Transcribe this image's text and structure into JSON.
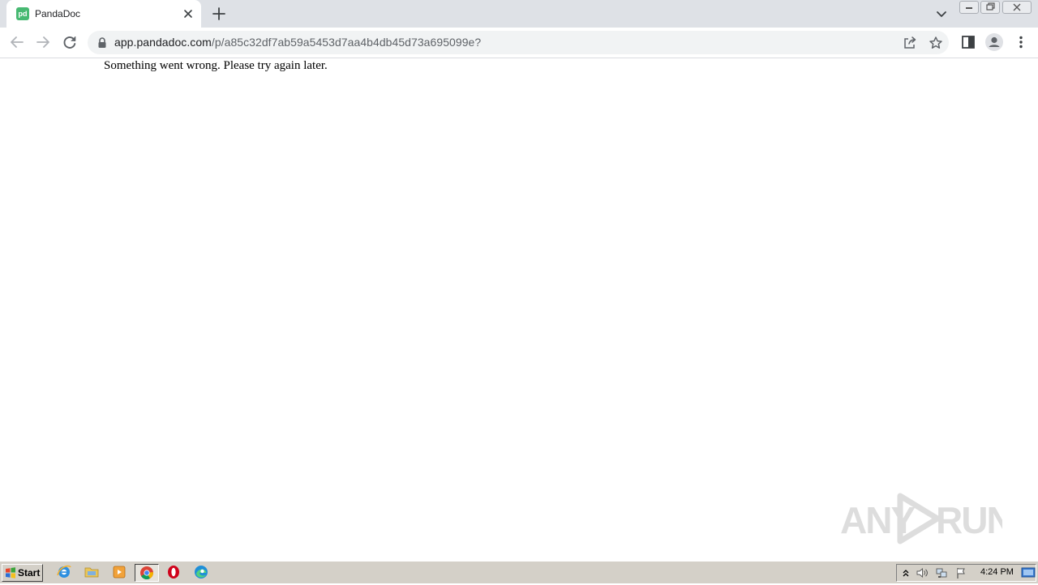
{
  "browser": {
    "tab": {
      "title": "PandaDoc",
      "favicon_text": "pd",
      "favicon_color": "#47b972"
    },
    "address_bar": {
      "host": "app.pandadoc.com",
      "path": "/p/a85c32df7ab59a5453d7aa4b4db45d73a695099e?"
    }
  },
  "page": {
    "message": "Something went wrong. Please try again later."
  },
  "watermark": {
    "text": "ANY RUN"
  },
  "taskbar": {
    "start_label": "Start",
    "apps": [
      "internet-explorer-icon",
      "folder-icon",
      "media-player-icon",
      "chrome-icon",
      "opera-icon",
      "edge-icon"
    ],
    "clock": "4:24 PM"
  }
}
